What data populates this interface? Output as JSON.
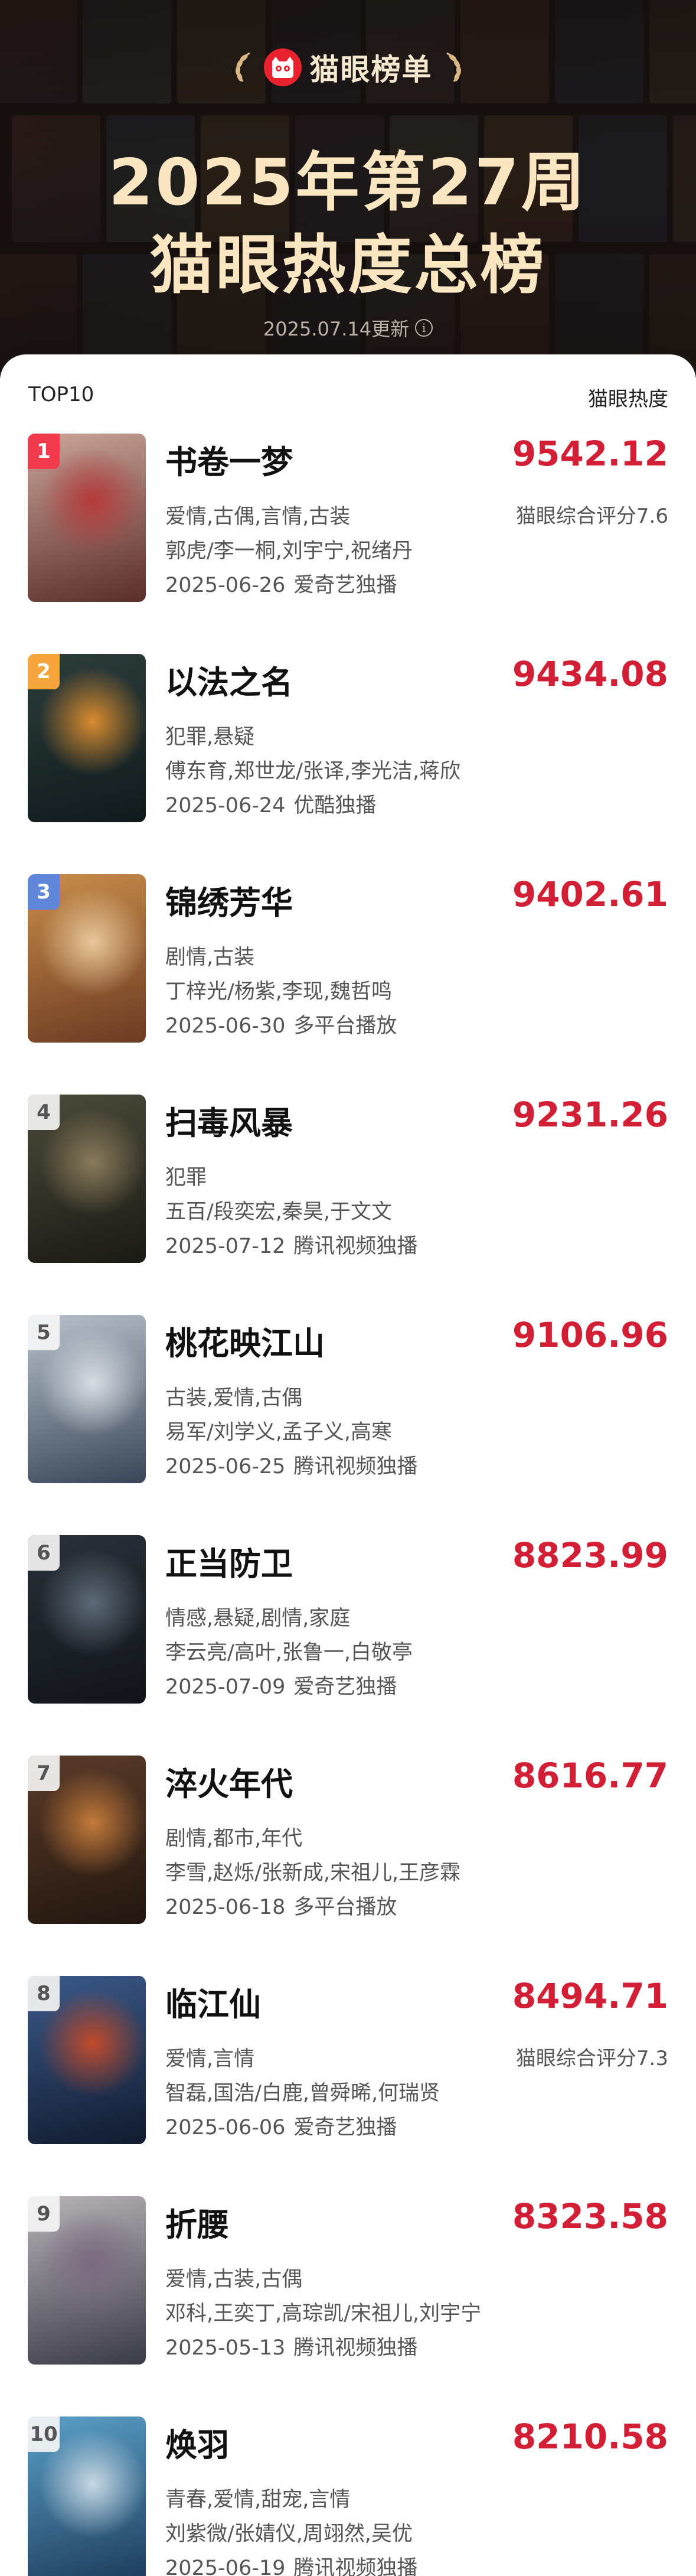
{
  "header": {
    "brand": "猫眼榜单",
    "brand_icon": "maoyan-cat-logo-icon",
    "title_line1": "2025年第27周",
    "title_line2": "猫眼热度总榜",
    "updated": "2025.07.14更新",
    "info_icon": "info-circle-icon"
  },
  "list": {
    "left_label": "TOP10",
    "right_label": "猫眼热度"
  },
  "colors": {
    "score": "#d31f36",
    "rank1": "#f03b4e",
    "rank2": "#f5a53b",
    "rank3": "#5f86d8",
    "header_bg": "#171312",
    "title": "#fbe6c2"
  },
  "items": [
    {
      "rank": "1",
      "name": "书卷一梦",
      "score": "9542.12",
      "rating": "猫眼综合评分7.6",
      "genres": "爱情,古偶,言情,古装",
      "cast": "郭虎/李一桐,刘宇宁,祝绪丹",
      "date": "2025-06-26",
      "platform": "爱奇艺独播"
    },
    {
      "rank": "2",
      "name": "以法之名",
      "score": "9434.08",
      "rating": "",
      "genres": "犯罪,悬疑",
      "cast": "傅东育,郑世龙/张译,李光洁,蒋欣",
      "date": "2025-06-24",
      "platform": "优酷独播"
    },
    {
      "rank": "3",
      "name": "锦绣芳华",
      "score": "9402.61",
      "rating": "",
      "genres": "剧情,古装",
      "cast": "丁梓光/杨紫,李现,魏哲鸣",
      "date": "2025-06-30",
      "platform": "多平台播放"
    },
    {
      "rank": "4",
      "name": "扫毒风暴",
      "score": "9231.26",
      "rating": "",
      "genres": "犯罪",
      "cast": "五百/段奕宏,秦昊,于文文",
      "date": "2025-07-12",
      "platform": "腾讯视频独播"
    },
    {
      "rank": "5",
      "name": "桃花映江山",
      "score": "9106.96",
      "rating": "",
      "genres": "古装,爱情,古偶",
      "cast": "易军/刘学义,孟子义,高寒",
      "date": "2025-06-25",
      "platform": "腾讯视频独播"
    },
    {
      "rank": "6",
      "name": "正当防卫",
      "score": "8823.99",
      "rating": "",
      "genres": "情感,悬疑,剧情,家庭",
      "cast": "李云亮/高叶,张鲁一,白敬亭",
      "date": "2025-07-09",
      "platform": "爱奇艺独播"
    },
    {
      "rank": "7",
      "name": "淬火年代",
      "score": "8616.77",
      "rating": "",
      "genres": "剧情,都市,年代",
      "cast": "李雪,赵烁/张新成,宋祖儿,王彦霖",
      "date": "2025-06-18",
      "platform": "多平台播放"
    },
    {
      "rank": "8",
      "name": "临江仙",
      "score": "8494.71",
      "rating": "猫眼综合评分7.3",
      "genres": "爱情,言情",
      "cast": "智磊,国浩/白鹿,曾舜晞,何瑞贤",
      "date": "2025-06-06",
      "platform": "爱奇艺独播"
    },
    {
      "rank": "9",
      "name": "折腰",
      "score": "8323.58",
      "rating": "",
      "genres": "爱情,古装,古偶",
      "cast": "邓科,王奕丁,高琮凯/宋祖儿,刘宇宁",
      "date": "2025-05-13",
      "platform": "腾讯视频独播"
    },
    {
      "rank": "10",
      "name": "焕羽",
      "score": "8210.58",
      "rating": "",
      "genres": "青春,爱情,甜宠,言情",
      "cast": "刘紫微/张婧仪,周翊然,吴优",
      "date": "2025-06-19",
      "platform": "腾讯视频独播"
    }
  ]
}
